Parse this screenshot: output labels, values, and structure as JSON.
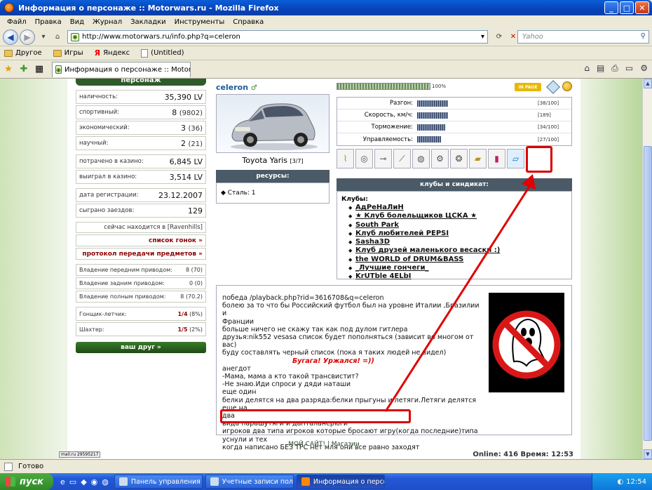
{
  "window": {
    "title": "Информация о персонаже :: Motorwars.ru - Mozilla Firefox"
  },
  "menu": [
    "Файл",
    "Правка",
    "Вид",
    "Журнал",
    "Закладки",
    "Инструменты",
    "Справка"
  ],
  "nav": {
    "url": "http://www.motorwars.ru/info.php?q=celeron",
    "search_placeholder": "Yahoo"
  },
  "bookmarks": [
    "Другое",
    "Игры",
    "Яндекс",
    "(Untitled)"
  ],
  "tab": {
    "label": "Информация о персонаже :: Motor..."
  },
  "left": {
    "header": "персонаж",
    "stats": [
      {
        "label": "наличность:",
        "value": "35,390 LV"
      },
      {
        "label": "спортивный:",
        "value": "8",
        "sub": "(9802)"
      },
      {
        "label": "экономический:",
        "value": "3",
        "sub": "(36)"
      },
      {
        "label": "научный:",
        "value": "2",
        "sub": "(21)"
      }
    ],
    "casino": [
      {
        "label": "потрачено в казино:",
        "value": "6,845 LV"
      },
      {
        "label": "выиграл в казино:",
        "value": "3,514 LV"
      }
    ],
    "reg": [
      {
        "label": "дата регистрации:",
        "value": "23.12.2007"
      },
      {
        "label": "сыграно заездов:",
        "value": "129"
      }
    ],
    "location": "сейчас находится в [Ravenhills]",
    "links": [
      "список гонок »",
      "протокол передачи предметов »"
    ],
    "drive": [
      {
        "label": "Владение передним приводом:",
        "value": "8",
        "sub": "(70)"
      },
      {
        "label": "Владение задним приводом:",
        "value": "0",
        "sub": "(0)"
      },
      {
        "label": "Владение полным приводом:",
        "value": "8",
        "sub": "(70.2)"
      }
    ],
    "ranks": [
      {
        "label": "Гонщик-летчик:",
        "value": "1/4",
        "sub": "(8%)"
      },
      {
        "label": "Шахтер:",
        "value": "1/5",
        "sub": "(2%)"
      }
    ],
    "friend_button": "ваш друг »"
  },
  "player": {
    "nick": "celeron",
    "car": "Toyota Yaris",
    "car_sub": "[3/7]"
  },
  "resources": {
    "header": "ресурсы:",
    "item": "Сталь: 1"
  },
  "progress": {
    "value": 100,
    "text": "100%",
    "badge": "IN PAGE"
  },
  "specs": [
    {
      "label": "Разгон:",
      "value": "[38/100]"
    },
    {
      "label": "Скорость, км/ч:",
      "value": "[189]"
    },
    {
      "label": "Торможение:",
      "value": "[34/100]"
    },
    {
      "label": "Управляемость:",
      "value": "[27/100]"
    }
  ],
  "clubs": {
    "header": "клубы и синдикат:",
    "title": "Клубы:",
    "items": [
      "АдРеНаЛиН",
      "★ Клуб болельщиков ЦСКА ★",
      "South Park",
      "Клуб любителей PEPSI",
      "Sasha3D",
      "Клуб друзей маленького весаски :)",
      "the WORLD of DRUM&BASS",
      "_Лучшие гончеги_",
      "KrUTble 4ELbI"
    ]
  },
  "about": {
    "lines": [
      "победа /playback.php?rid=3616708&q=celeron",
      "болею за то что бы Российский футбол был на уровне Италии ,Бразилии и",
      "Франции",
      "больше ничего не скажу так как под дулом гитлера",
      "друзья:nik552 vesasa список будет пополняться (зависит во многом от вас)",
      "буду составлять черный список (пока я таких людей не видел)",
      "",
      "анегдот",
      "-Мама, мама а кто такой трансвистит?",
      "-Не знаю.Иди спроси у дяди наташи",
      "еще один",
      "белки делятся на два разряда:белки прыгуны и летяги.Летяги делятся еще на",
      "два",
      "вида парашутяги и дапталанерюги",
      "игроков два типа игроков которые бросают игру(когда последние)типа уснули и тех",
      "когда написано БЕЗ ТРС нет мля они все равно заходят"
    ],
    "annotation": "Бугага! Уржался! =))"
  },
  "footer": {
    "links": "МОЙ САЙТ! | Магазин",
    "online": "Online: 416  Время: 12:53",
    "counter": "mail.ru 29595217"
  },
  "status": {
    "text": "Готово"
  },
  "taskbar": {
    "start": "пуск",
    "tasks": [
      "Панель управления",
      "Учетные записи пол...",
      "Информация о персо..."
    ],
    "clock": "12:54"
  }
}
